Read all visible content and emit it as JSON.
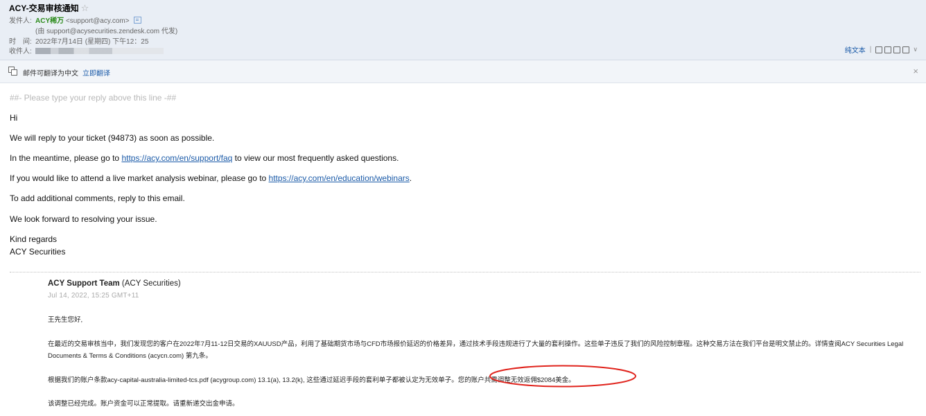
{
  "header": {
    "subject": "ACY-交易审核通知",
    "star_icon": "star-outline-icon",
    "from_label": "发件人:",
    "sender_name": "ACY稀万",
    "sender_email": "<support@acy.com>",
    "via_text": "(由 support@acysecurities.zendesk.com 代发)",
    "time_label": "时　间:",
    "time_value": "2022年7月14日 (星期四) 下午12：25",
    "to_label": "收件人:"
  },
  "toolbar": {
    "plain_text_label": "纯文本",
    "icons": [
      "new-window-icon",
      "copy-icon",
      "print-preview-icon",
      "print-icon"
    ]
  },
  "translate_bar": {
    "message": "邮件可翻译为中文",
    "action_label": "立即翻译",
    "close_symbol": "×"
  },
  "body": {
    "reply_line": "##- Please type your reply above this line -##",
    "greeting": "Hi",
    "line1": "We will reply to your ticket (94873) as soon as possible.",
    "line2_pre": "In the meantime, please go to ",
    "faq_link": "https://acy.com/en/support/faq",
    "line2_post": " to view our most frequently asked questions.",
    "line3_pre": "If you would like to attend a live market analysis webinar, please go to ",
    "webinar_link": "https://acy.com/en/education/webinars",
    "line3_post": ".",
    "line4": "To add additional comments, reply to this email.",
    "line5": "We look forward to resolving your issue.",
    "signoff1": "Kind regards",
    "signoff2": "ACY Securities"
  },
  "quoted": {
    "team_name": "ACY Support Team",
    "team_company": " (ACY Securities)",
    "date": "Jul 14, 2022, 15:25 GMT+11",
    "salutation": "王先生您好,",
    "para1_line1": "在最近的交易审核当中，我们发现您的客户在2022年7月11-12日交易的XAUUSD产品，利用了基础期货市场与CFD市场报价延迟的价格差异，通过技术手段违规进行了大量的套利操作。这些单子违反了我们的风险控制章程。这种交易方法在我们平台是明文禁止的。详情查阅ACY Securities Legal",
    "para1_line2": "Documents & Terms & Conditions (acycn.com) 第九条。",
    "para2": "根据我们的账户条款acy-capital-australia-limited-tcs.pdf (acygroup.com) 13.1(a), 13.2(k), 这些通过延迟手段的套利单子都被认定为无效单子。您的账户共需调整无效返佣$2084美金。",
    "para3": "该调整已经完成。账户资金可以正常提取。请重新递交出金申请。"
  },
  "colors": {
    "header_bg": "#e9eef5",
    "link": "#1a5aa8",
    "sender_green": "#2c8b1b",
    "annotation_red": "#e0231c"
  }
}
